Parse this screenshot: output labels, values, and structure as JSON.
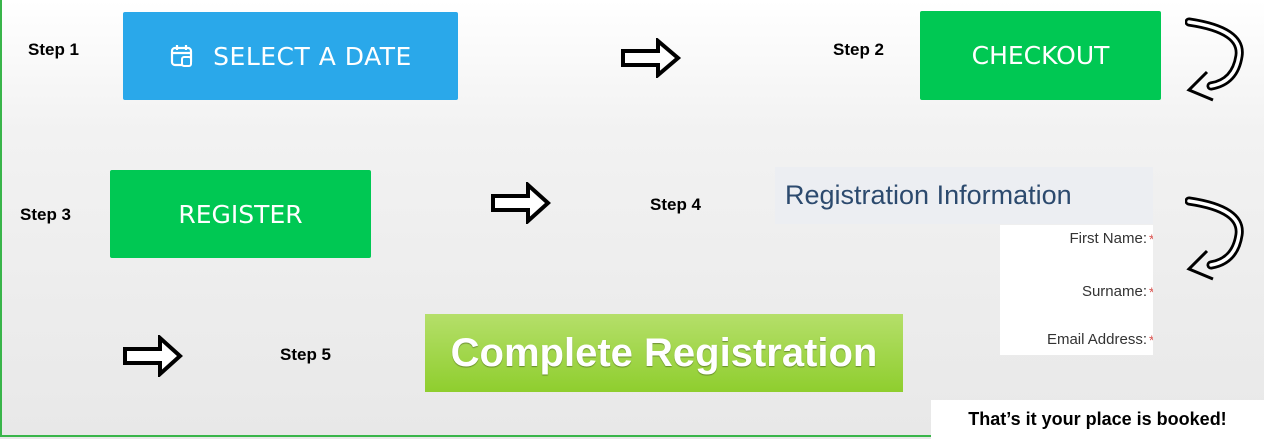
{
  "steps": {
    "step1": "Step 1",
    "step2": "Step 2",
    "step3": "Step 3",
    "step4": "Step 4",
    "step5": "Step 5"
  },
  "buttons": {
    "select_date": "SELECT A DATE",
    "checkout": "CHECKOUT",
    "register": "REGISTER",
    "complete_registration": "Complete Registration"
  },
  "registration_form": {
    "title": "Registration Information",
    "fields": [
      "First Name:",
      "Surname:",
      "Email Address:"
    ],
    "required_marker": "*"
  },
  "closing_note": "That’s it your place is booked!",
  "colors": {
    "select_date_bg": "#2aa8ea",
    "checkout_bg": "#00c853",
    "register_bg": "#00c853",
    "complete_bg": "#8fce2e",
    "form_title": "#2c4a6e",
    "frame_border": "#39b54a"
  },
  "icons": {
    "select_date": "calendar-icon",
    "flow": "right-arrow-icon",
    "wrap": "curved-return-arrow-icon"
  }
}
